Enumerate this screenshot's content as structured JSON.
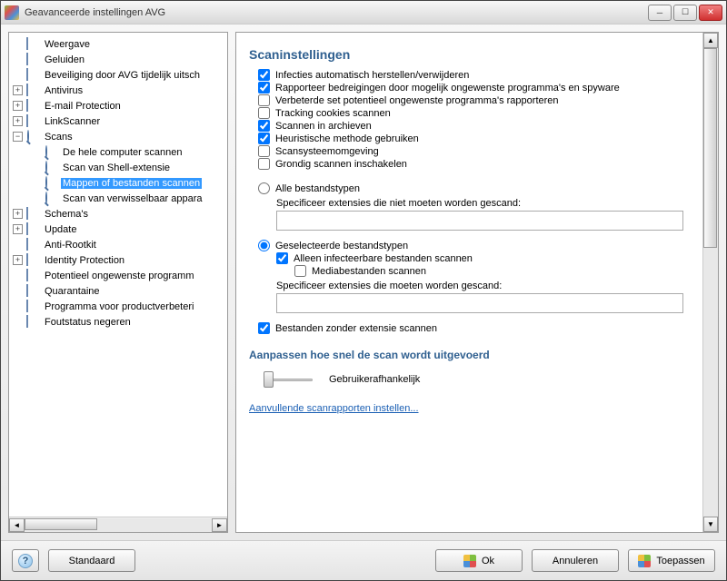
{
  "window": {
    "title": "Geavanceerde instellingen AVG"
  },
  "tree": {
    "items": [
      {
        "label": "Weergave",
        "depth": 0,
        "expand": "none",
        "icon": "box"
      },
      {
        "label": "Geluiden",
        "depth": 0,
        "expand": "none",
        "icon": "box"
      },
      {
        "label": "Beveiliging door AVG tijdelijk uitsch",
        "depth": 0,
        "expand": "none",
        "icon": "box"
      },
      {
        "label": "Antivirus",
        "depth": 0,
        "expand": "plus",
        "icon": "box"
      },
      {
        "label": "E-mail Protection",
        "depth": 0,
        "expand": "plus",
        "icon": "box"
      },
      {
        "label": "LinkScanner",
        "depth": 0,
        "expand": "plus",
        "icon": "box"
      },
      {
        "label": "Scans",
        "depth": 0,
        "expand": "minus",
        "icon": "mag"
      },
      {
        "label": "De hele computer scannen",
        "depth": 1,
        "expand": "none",
        "icon": "mag"
      },
      {
        "label": "Scan van Shell-extensie",
        "depth": 1,
        "expand": "none",
        "icon": "mag"
      },
      {
        "label": "Mappen of bestanden scannen",
        "depth": 1,
        "expand": "none",
        "icon": "mag",
        "selected": true
      },
      {
        "label": "Scan van verwisselbaar appara",
        "depth": 1,
        "expand": "none",
        "icon": "mag"
      },
      {
        "label": "Schema's",
        "depth": 0,
        "expand": "plus",
        "icon": "box"
      },
      {
        "label": "Update",
        "depth": 0,
        "expand": "plus",
        "icon": "box"
      },
      {
        "label": "Anti-Rootkit",
        "depth": 0,
        "expand": "none",
        "icon": "box"
      },
      {
        "label": "Identity Protection",
        "depth": 0,
        "expand": "plus",
        "icon": "box"
      },
      {
        "label": "Potentieel ongewenste programm",
        "depth": 0,
        "expand": "none",
        "icon": "box"
      },
      {
        "label": "Quarantaine",
        "depth": 0,
        "expand": "none",
        "icon": "box"
      },
      {
        "label": "Programma voor productverbeteri",
        "depth": 0,
        "expand": "none",
        "icon": "box"
      },
      {
        "label": "Foutstatus negeren",
        "depth": 0,
        "expand": "none",
        "icon": "box"
      }
    ]
  },
  "main": {
    "title": "Scaninstellingen",
    "checks": [
      {
        "label": "Infecties automatisch herstellen/verwijderen",
        "checked": true
      },
      {
        "label": "Rapporteer bedreigingen door mogelijk ongewenste programma's en spyware",
        "checked": true
      },
      {
        "label": "Verbeterde set potentieel ongewenste programma's rapporteren",
        "checked": false
      },
      {
        "label": "Tracking cookies scannen",
        "checked": false
      },
      {
        "label": "Scannen in archieven",
        "checked": true
      },
      {
        "label": "Heuristische methode gebruiken",
        "checked": true
      },
      {
        "label": "Scansysteemomgeving",
        "checked": false
      },
      {
        "label": "Grondig scannen inschakelen",
        "checked": false
      }
    ],
    "radio_all": "Alle bestandstypen",
    "exclude_label": "Specificeer extensies die niet moeten worden gescand:",
    "exclude_value": "",
    "radio_selected": "Geselecteerde bestandstypen",
    "only_infectable": "Alleen infecteerbare bestanden scannen",
    "media_files": "Mediabestanden scannen",
    "include_label": "Specificeer extensies die moeten worden gescand:",
    "include_value": "",
    "no_ext": "Bestanden zonder extensie scannen",
    "speed_title": "Aanpassen hoe snel de scan wordt uitgevoerd",
    "speed_value": "Gebruikerafhankelijk",
    "link": "Aanvullende scanrapporten instellen..."
  },
  "buttons": {
    "help": "?",
    "default": "Standaard",
    "ok": "Ok",
    "cancel": "Annuleren",
    "apply": "Toepassen"
  }
}
